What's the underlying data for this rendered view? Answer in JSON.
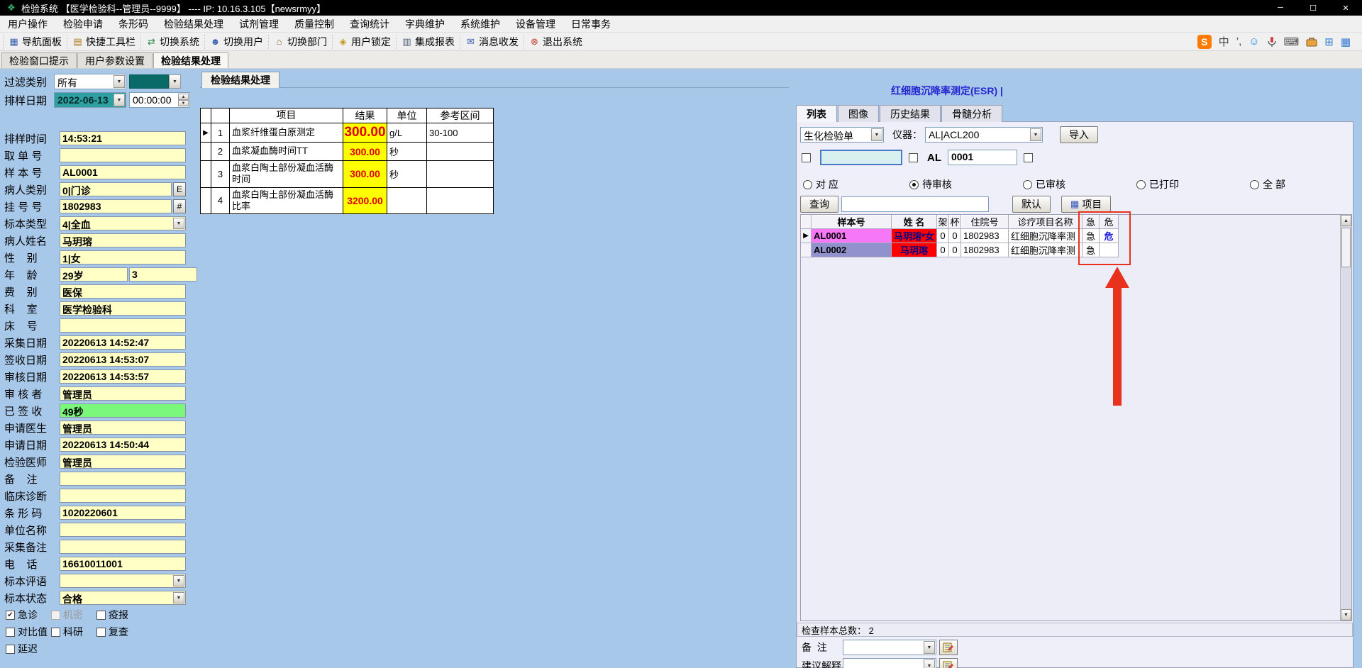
{
  "icons": {
    "dropdown_arrow": "▼",
    "spin_up": "▲",
    "spin_down": "▼",
    "row_marker": "▶",
    "check": "✔",
    "window_min": "─",
    "window_max": "☐",
    "window_close": "✕",
    "scroll_up": "▲",
    "scroll_down": "▼",
    "app_logo": "❖",
    "sogou": "S",
    "ime_mode": "中",
    "ime_punct": "’,",
    "ime_emoji": "☺",
    "ime_keyboard": "⌨",
    "blue_tool_1": "⊞",
    "blue_tool_2": "▦",
    "project_grid": "▦"
  },
  "titlebar": {
    "title": "检验系统 【医学检验科--管理员--9999】 ----  IP:  10.16.3.105【newsrmyy】"
  },
  "menubar": {
    "items": [
      {
        "label": "用户操作"
      },
      {
        "label": "检验申请"
      },
      {
        "label": "条形码"
      },
      {
        "label": "检验结果处理"
      },
      {
        "label": "试剂管理"
      },
      {
        "label": "质量控制"
      },
      {
        "label": "查询统计"
      },
      {
        "label": "字典维护"
      },
      {
        "label": "系统维护"
      },
      {
        "label": "设备管理"
      },
      {
        "label": "日常事务"
      }
    ]
  },
  "toolbar": {
    "items": [
      {
        "label": "导航面板",
        "glyph": "▦",
        "color": "#3A62B0"
      },
      {
        "label": "快捷工具栏",
        "glyph": "▤",
        "color": "#B07A20"
      },
      {
        "label": "切换系统",
        "glyph": "⇄",
        "color": "#2F8A4A"
      },
      {
        "label": "切换用户",
        "glyph": "☻",
        "color": "#3A62B0"
      },
      {
        "label": "切换部门",
        "glyph": "⌂",
        "color": "#8A5A20"
      },
      {
        "label": "用户锁定",
        "glyph": "◈",
        "color": "#C29A1E"
      },
      {
        "label": "集成报表",
        "glyph": "▥",
        "color": "#50607A"
      },
      {
        "label": "消息收发",
        "glyph": "✉",
        "color": "#3A62B0"
      },
      {
        "label": "退出系统",
        "glyph": "⊗",
        "color": "#C03A2A"
      }
    ]
  },
  "main_tabs": {
    "items": [
      {
        "label": "检验窗口提示"
      },
      {
        "label": "用户参数设置"
      },
      {
        "label": "检验结果处理",
        "active": true
      }
    ]
  },
  "left_panel": {
    "filter_label": "过滤类别",
    "filter_value": "所有",
    "date_label": "排样日期",
    "date_value": "2022-06-13",
    "time_value": "00:00:00",
    "fields": [
      {
        "label": "排样时间",
        "value": "14:53:21"
      },
      {
        "label": "取 单 号",
        "value": ""
      },
      {
        "label": "样 本 号",
        "value": "AL0001"
      },
      {
        "label": "病人类别",
        "value": "0|门诊",
        "btn": "E"
      },
      {
        "label": "挂 号 号",
        "value": "1802983",
        "btn": "#"
      },
      {
        "label": "标本类型",
        "value": "4|全血",
        "dropdown": true
      },
      {
        "label": "病人姓名",
        "value": "马玥瑢"
      },
      {
        "label": "性    别",
        "value": "1|女"
      },
      {
        "label": "年    龄",
        "value": "29岁",
        "value2": "3"
      },
      {
        "label": "费    别",
        "value": "医保"
      },
      {
        "label": "科    室",
        "value": "医学检验科"
      },
      {
        "label": "床    号",
        "value": ""
      },
      {
        "label": "采集日期",
        "value": "20220613 14:52:47"
      },
      {
        "label": "签收日期",
        "value": "20220613 14:53:07"
      },
      {
        "label": "审核日期",
        "value": "20220613 14:53:57"
      },
      {
        "label": "审 核 者",
        "value": "管理员"
      },
      {
        "label": "已 签 收",
        "value": "49秒",
        "green": true
      },
      {
        "label": "申请医生",
        "value": "管理员"
      },
      {
        "label": "申请日期",
        "value": "20220613 14:50:44"
      },
      {
        "label": "检验医师",
        "value": "管理员"
      },
      {
        "label": "备    注",
        "value": ""
      },
      {
        "label": "临床诊断",
        "value": ""
      },
      {
        "label": "条 形 码",
        "value": "1020220601"
      },
      {
        "label": "单位名称",
        "value": ""
      },
      {
        "label": "采集备注",
        "value": ""
      },
      {
        "label": "电    话",
        "value": "16610011001"
      },
      {
        "label": "标本评语",
        "value": "",
        "dropdown": true
      },
      {
        "label": "标本状态",
        "value": "合格",
        "dropdown": true
      }
    ],
    "cb_row1": [
      {
        "label": "急诊",
        "checked": true
      },
      {
        "label": "机密",
        "disabled": true
      },
      {
        "label": "疫报"
      }
    ],
    "cb_row2": [
      {
        "label": "对比值"
      },
      {
        "label": "科研"
      },
      {
        "label": "复查"
      }
    ],
    "cb_row3": [
      {
        "label": "延迟"
      }
    ]
  },
  "middle_panel": {
    "tab_label": "检验结果处理",
    "table": {
      "headers": [
        "项目",
        "结果",
        "单位",
        "参考区间"
      ],
      "rows": [
        {
          "num": "1",
          "item": "血浆纤维蛋白原测定",
          "result": "300.00",
          "unit": "g/L",
          "range": "30-100",
          "selected": true,
          "big": true
        },
        {
          "num": "2",
          "item": "血浆凝血酶时间TT",
          "result": "300.00",
          "unit": "秒",
          "range": ""
        },
        {
          "num": "3",
          "item": "血浆白陶土部份凝血活酶时间",
          "result": "300.00",
          "unit": "秒",
          "range": ""
        },
        {
          "num": "4",
          "item": "血浆白陶土部份凝血活酶比率",
          "result": "3200.00",
          "unit": "",
          "range": ""
        }
      ]
    }
  },
  "right_panel": {
    "header_link": "红细胞沉降率测定(ESR) |",
    "tabs": [
      {
        "label": "列表",
        "active": true
      },
      {
        "label": "图像"
      },
      {
        "label": "历史结果"
      },
      {
        "label": "骨髓分析"
      }
    ],
    "sheet_type": "生化检验单",
    "instrument_label": "仪器：",
    "instrument_value": "AL|ACL200",
    "import_label": "导入",
    "filter_box_value": "",
    "al_label": "AL",
    "al_value": "0001",
    "radios": [
      {
        "label": "对 应"
      },
      {
        "label": "待审核",
        "checked": true
      },
      {
        "label": "已审核"
      },
      {
        "label": "已打印"
      },
      {
        "label": "全 部"
      }
    ],
    "query_label": "查询",
    "query_value": "",
    "default_label": "默认",
    "project_label": "项目",
    "table": {
      "headers": [
        "样本号",
        "姓 名",
        "架",
        "杯",
        "住院号",
        "诊疗项目名称",
        "急",
        "危"
      ],
      "rows": [
        {
          "sample": "AL0001",
          "sample_bg": "#F678F6",
          "name": "马玥瑢*女",
          "name_bg": "#FF0000",
          "name_color": "#00008B",
          "rack": "0",
          "cup": "0",
          "hosp": "1802983",
          "project": "红细胞沉降率测",
          "urgent": "急",
          "critical": "危",
          "selected": true
        },
        {
          "sample": "AL0002",
          "sample_bg": "#9191CD",
          "name": "马玥瑢",
          "name_bg": "#FF0000",
          "name_color": "#00008B",
          "rack": "0",
          "cup": "0",
          "hosp": "1802983",
          "project": "红细胞沉降率测",
          "urgent": "急",
          "critical": ""
        }
      ]
    },
    "total_text": "检查样本总数： 2",
    "remark_label": "备  注",
    "remark_value": "",
    "suggest_label": "建议解释",
    "suggest_value": "",
    "annotation_color": "#E8321E"
  }
}
